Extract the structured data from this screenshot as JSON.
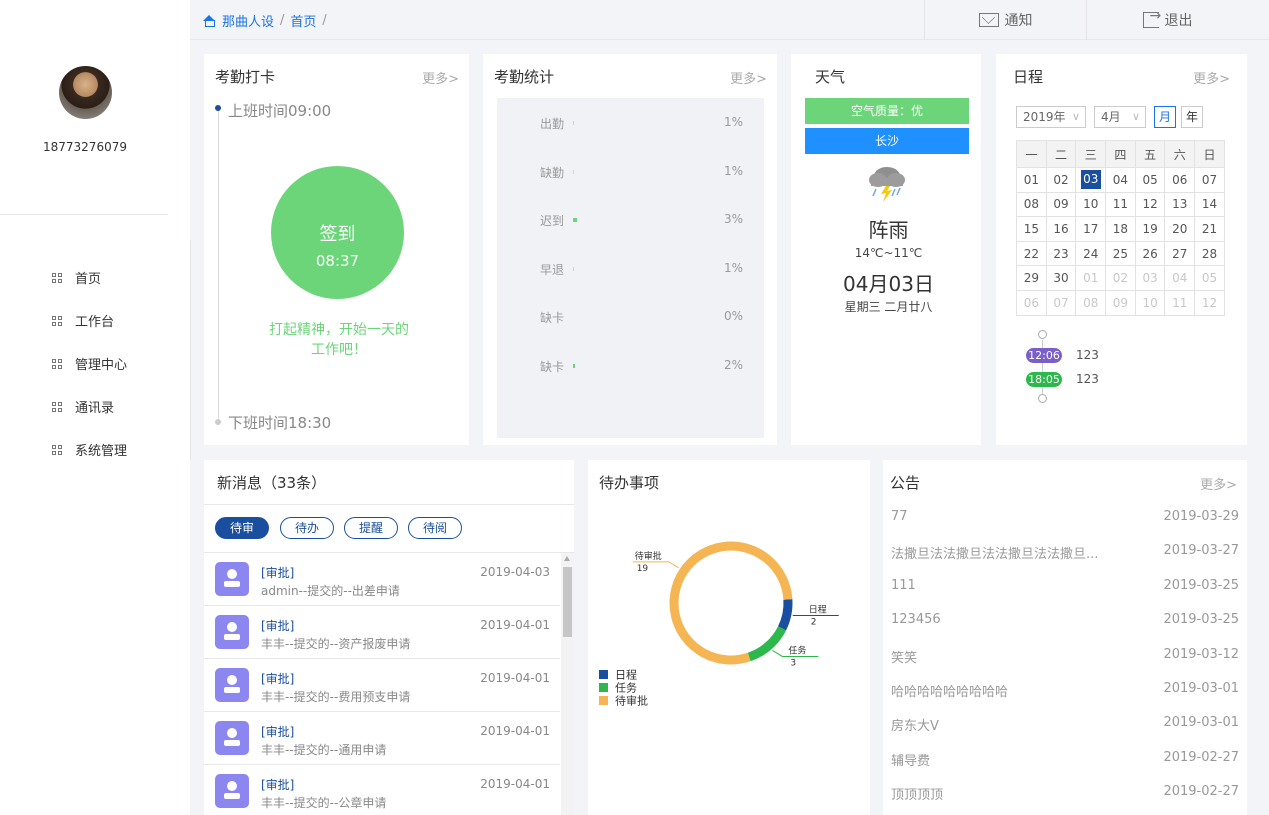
{
  "user": {
    "phone": "18773276079"
  },
  "nav": [
    {
      "label": "首页"
    },
    {
      "label": "工作台"
    },
    {
      "label": "管理中心"
    },
    {
      "label": "通讯录"
    },
    {
      "label": "系统管理"
    }
  ],
  "breadcrumb": {
    "root": "那曲人设",
    "sep1": "/",
    "current": "首页",
    "sep2": "/"
  },
  "topbar": {
    "notify": "通知",
    "logout": "退出"
  },
  "attendance": {
    "title": "考勤打卡",
    "more": "更多>",
    "start": "上班时间09:00",
    "end": "下班时间18:30",
    "button": "签到",
    "time": "08:37",
    "motto": "打起精神，开始一天的工作吧！"
  },
  "stats": {
    "title": "考勤统计",
    "more": "更多>",
    "rows": [
      {
        "label": "出勤",
        "value": 1,
        "pct": "1%"
      },
      {
        "label": "缺勤",
        "value": 1,
        "pct": "1%"
      },
      {
        "label": "迟到",
        "value": 3,
        "pct": "3%"
      },
      {
        "label": "早退",
        "value": 1,
        "pct": "1%"
      },
      {
        "label": "缺卡",
        "value": 0,
        "pct": "0%"
      },
      {
        "label": "缺卡",
        "value": 2,
        "pct": "2%"
      }
    ]
  },
  "weather": {
    "title": "天气",
    "air": "空气质量：优",
    "city": "长沙",
    "condition": "阵雨",
    "temp": "14℃~11℃",
    "date": "04月03日",
    "lunar": "星期三 二月廿八",
    "icon": "thunder-rain-cloud-icon"
  },
  "calendar": {
    "title": "日程",
    "more": "更多>",
    "year": "2019年",
    "month": "4月",
    "btn_month": "月",
    "btn_year": "年",
    "weekdays": [
      "一",
      "二",
      "三",
      "四",
      "五",
      "六",
      "日"
    ],
    "weeks": [
      [
        "01",
        "02",
        "03",
        "04",
        "05",
        "06",
        "07"
      ],
      [
        "08",
        "09",
        "10",
        "11",
        "12",
        "13",
        "14"
      ],
      [
        "15",
        "16",
        "17",
        "18",
        "19",
        "20",
        "21"
      ],
      [
        "22",
        "23",
        "24",
        "25",
        "26",
        "27",
        "28"
      ],
      [
        "29",
        "30",
        "01",
        "02",
        "03",
        "04",
        "05"
      ],
      [
        "06",
        "07",
        "08",
        "09",
        "10",
        "11",
        "12"
      ]
    ],
    "today": "03",
    "events": [
      {
        "time": "12:06",
        "text": "123",
        "color": "#7b5fc9"
      },
      {
        "time": "18:05",
        "text": "123",
        "color": "#2db84c"
      }
    ]
  },
  "messages": {
    "title": "新消息（33条）",
    "tabs": [
      "待审",
      "待办",
      "提醒",
      "待阅"
    ],
    "items": [
      {
        "type": "[审批]",
        "desc": "admin--提交的--出差申请",
        "date": "2019-04-03"
      },
      {
        "type": "[审批]",
        "desc": "丰丰--提交的--资产报废申请",
        "date": "2019-04-01"
      },
      {
        "type": "[审批]",
        "desc": "丰丰--提交的--费用预支申请",
        "date": "2019-04-01"
      },
      {
        "type": "[审批]",
        "desc": "丰丰--提交的--通用申请",
        "date": "2019-04-01"
      },
      {
        "type": "[审批]",
        "desc": "丰丰--提交的--公章申请",
        "date": "2019-04-01"
      }
    ]
  },
  "todo": {
    "title": "待办事项"
  },
  "chart_data": {
    "type": "pie",
    "title": "待办事项",
    "categories": [
      "日程",
      "任务",
      "待审批"
    ],
    "values": [
      2,
      3,
      19
    ],
    "colors": [
      "#1a4e9e",
      "#2db84c",
      "#f5b553"
    ],
    "donut": true,
    "legend": "bottom-left"
  },
  "notices": {
    "title": "公告",
    "more": "更多>",
    "items": [
      {
        "text": "77",
        "date": "2019-03-29"
      },
      {
        "text": "法撒旦法法撒旦法法撒旦法法撒旦...",
        "date": "2019-03-27"
      },
      {
        "text": "111",
        "date": "2019-03-25"
      },
      {
        "text": "123456",
        "date": "2019-03-25"
      },
      {
        "text": "笑笑",
        "date": "2019-03-12"
      },
      {
        "text": "哈哈哈哈哈哈哈哈哈",
        "date": "2019-03-01"
      },
      {
        "text": "房东大V",
        "date": "2019-03-01"
      },
      {
        "text": "辅导费",
        "date": "2019-02-27"
      },
      {
        "text": "顶顶顶顶",
        "date": "2019-02-27"
      }
    ]
  }
}
